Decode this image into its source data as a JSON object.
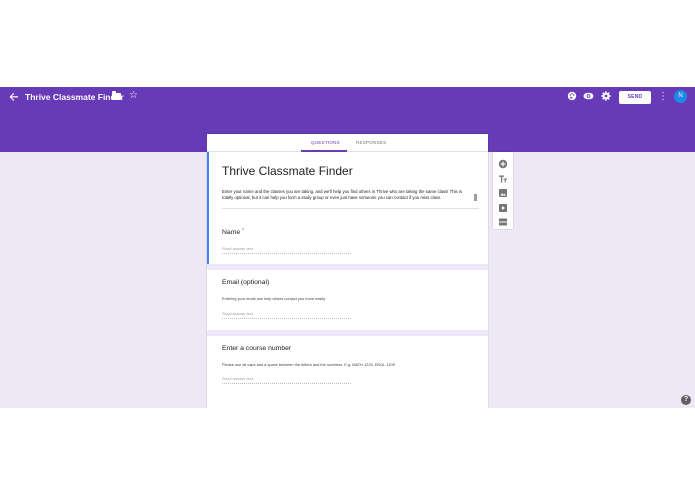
{
  "app": {
    "title": "Thrive Classmate Finder",
    "send_label": "SEND",
    "avatar_initial": "N",
    "accent_color": "#673ab7",
    "background_color": "#ede7f6"
  },
  "tabs": [
    {
      "label": "QUESTIONS",
      "active": true
    },
    {
      "label": "RESPONSES",
      "active": false
    }
  ],
  "form": {
    "title": "Thrive Classmate Finder",
    "description": "Enter your name and the classes you are taking, and we'll help you find others in Thrive who are taking the same class! This is totally optional, but it can help you form a study group or even just have someone you can contact if you miss class."
  },
  "questions": [
    {
      "title": "Name",
      "required": true,
      "help": "",
      "placeholder": "Short answer text"
    },
    {
      "title": "Email (optional)",
      "required": false,
      "help": "Entering your email can help others contact you more easily.",
      "placeholder": "Short answer text"
    },
    {
      "title": "Enter a course number",
      "required": false,
      "help": "Please use all caps and a space between the letters and the numbers. E.g. MATH 1225, ENGL 1105",
      "placeholder": "Short answer text"
    }
  ],
  "toolbar_icons": [
    "back-arrow-icon",
    "folder-icon",
    "star-icon",
    "palette-icon",
    "eye-icon",
    "gear-icon",
    "more-vert-icon"
  ],
  "rail_icons": [
    "add-question-icon",
    "title-text-icon",
    "image-icon",
    "video-icon",
    "section-icon"
  ],
  "help_label": "?"
}
